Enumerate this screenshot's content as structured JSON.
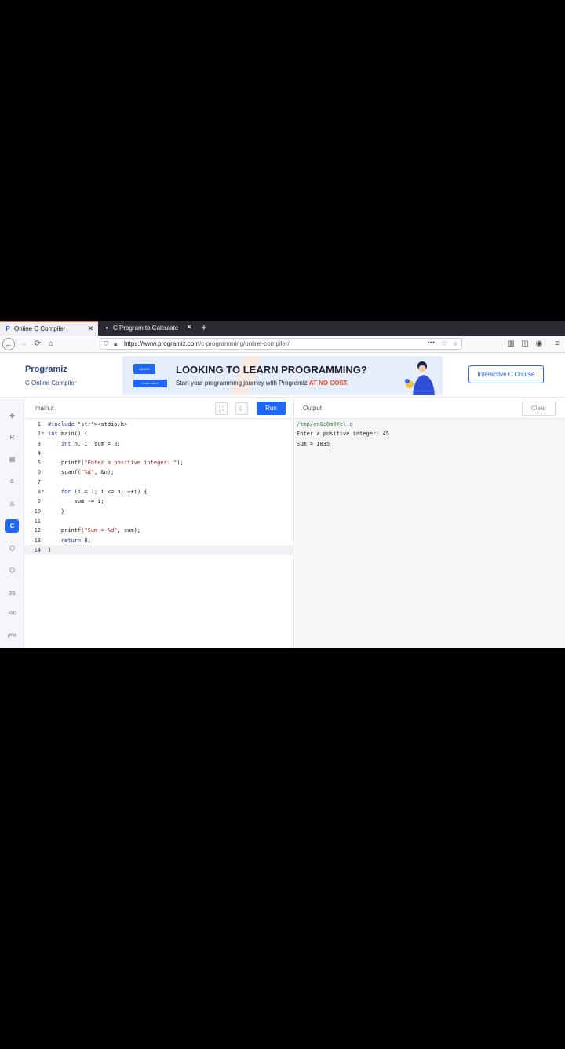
{
  "browser": {
    "tabs": [
      {
        "title": "Online C Compiler",
        "active": true
      },
      {
        "title": "C Program to Calculate",
        "active": false
      }
    ],
    "new_tab": "+",
    "url_host": "https://www.programiz.com",
    "url_path": "/c-programming/online-compiler/"
  },
  "header": {
    "logo": "Programiz",
    "subtitle": "C Online Compiler",
    "interactive_course": "Interactive C Course"
  },
  "banner": {
    "badge": "LEARN PYTHON",
    "learn_more": "Learn More",
    "headline": "LOOKING TO LEARN PROGRAMMING?",
    "sub_pre": "Start your programming journey with Programiz ",
    "sub_emph": "AT NO COST."
  },
  "rail": {
    "languages": [
      "python",
      "r",
      "sql",
      "html",
      "java",
      "c",
      "cpp",
      "csharp",
      "js",
      "go",
      "php"
    ],
    "labels": {
      "js": "JS",
      "go": "-GO",
      "php": "php",
      "c": "C"
    },
    "active": "c"
  },
  "editor": {
    "filename": "main.c",
    "run_label": "Run",
    "lines": [
      "#include <stdio.h>",
      "int main() {",
      "    int n, i, sum = 0;",
      "",
      "    printf(\"Enter a positive integer: \");",
      "    scanf(\"%d\", &n);",
      "",
      "    for (i = 1; i <= n; ++i) {",
      "        sum += i;",
      "    }",
      "",
      "    printf(\"Sum = %d\", sum);",
      "    return 0;",
      "}"
    ]
  },
  "output": {
    "title": "Output",
    "clear_label": "Clear",
    "lines": [
      "/tmp/enGcOm6Ycl.o",
      "Enter a positive integer: 45",
      "Sum = 1035"
    ]
  }
}
